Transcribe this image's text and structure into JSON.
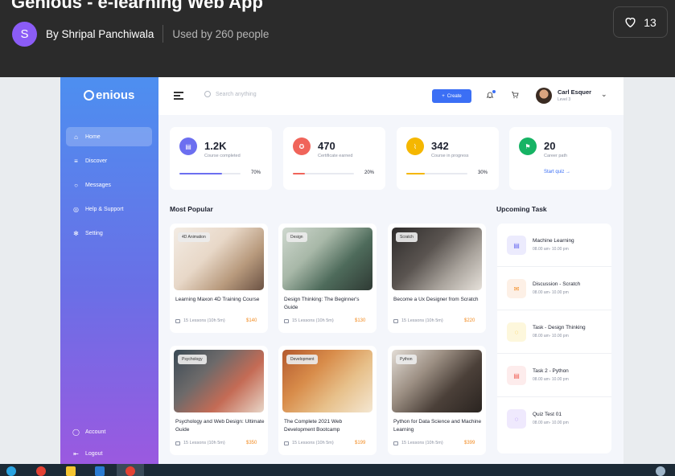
{
  "shot": {
    "title": "Genious - e-learning Web App",
    "author_initial": "S",
    "author": "By Shripal Panchiwala",
    "used_by": "Used by 260 people",
    "likes": "13"
  },
  "app": {
    "logo": "enious",
    "search_placeholder": "Search anything",
    "create_label": "Create",
    "user": {
      "name": "Carl Esquer",
      "level": "Level 3"
    },
    "nav": [
      {
        "label": "Home",
        "icon": "home-icon"
      },
      {
        "label": "Discover",
        "icon": "list-icon"
      },
      {
        "label": "Messages",
        "icon": "chat-icon"
      },
      {
        "label": "Help & Support",
        "icon": "help-icon"
      },
      {
        "label": "Setting",
        "icon": "gear-icon"
      }
    ],
    "nav_bottom": [
      {
        "label": "Account",
        "icon": "user-icon"
      },
      {
        "label": "Logout",
        "icon": "logout-icon"
      }
    ],
    "stats": [
      {
        "value": "1.2K",
        "label": "Course completed",
        "progress": 0.7,
        "pct": "70%",
        "color": "#6c6ff0"
      },
      {
        "value": "470",
        "label": "Certificate earned",
        "progress": 0.2,
        "pct": "20%",
        "color": "#f0645a"
      },
      {
        "value": "342",
        "label": "Course in progress",
        "progress": 0.3,
        "pct": "30%",
        "color": "#f5b700"
      },
      {
        "value": "20",
        "label": "Career path",
        "link": "Start quiz →",
        "color": "#16b364"
      }
    ],
    "most_popular_title": "Most Popular",
    "upcoming_title": "Upcoming Task",
    "courses": [
      {
        "tag": "4D Animation",
        "title": "Learning Maxon 4D Training Course",
        "lessons": "15 Lessons (10h 5m)",
        "price": "$140"
      },
      {
        "tag": "Design",
        "title": "Design Thinking: The Beginner's Guide",
        "lessons": "15 Lessons (10h 5m)",
        "price": "$130"
      },
      {
        "tag": "Scratch",
        "title": "Become a Ux Designer from Scratch",
        "lessons": "15 Lessons (10h 5m)",
        "price": "$220"
      },
      {
        "tag": "Psychology",
        "title": "Psychology and Web Design: Ultimate Guide",
        "lessons": "15 Lessons (10h 5m)",
        "price": "$350"
      },
      {
        "tag": "Development",
        "title": "The Complete 2021 Web Development Bootcamp",
        "lessons": "15 Lessons (10h 5m)",
        "price": "$199"
      },
      {
        "tag": "Python",
        "title": "Python for Data Science and Machine Learning",
        "lessons": "15 Lessons (10h 5m)",
        "price": "$399"
      }
    ],
    "tasks": [
      {
        "name": "Machine Learning",
        "time": "08.00 am- 10.00 pm",
        "bg": "#ecebfd",
        "fg": "#6c6ff0"
      },
      {
        "name": "Discussion - Scratch",
        "time": "08.00 am- 10.00 pm",
        "bg": "#fdf0e6",
        "fg": "#f28a1f"
      },
      {
        "name": "Task - Design Thinking",
        "time": "08.00 am- 10.00 pm",
        "bg": "#fdf7dc",
        "fg": "#f5b700"
      },
      {
        "name": "Task 2 - Python",
        "time": "08.00 am- 10.00 pm",
        "bg": "#fdecec",
        "fg": "#f0645a"
      },
      {
        "name": "Quiz Test 01",
        "time": "08.00 am- 10.00 pm",
        "bg": "#efe9fd",
        "fg": "#8b5cf6"
      }
    ]
  }
}
